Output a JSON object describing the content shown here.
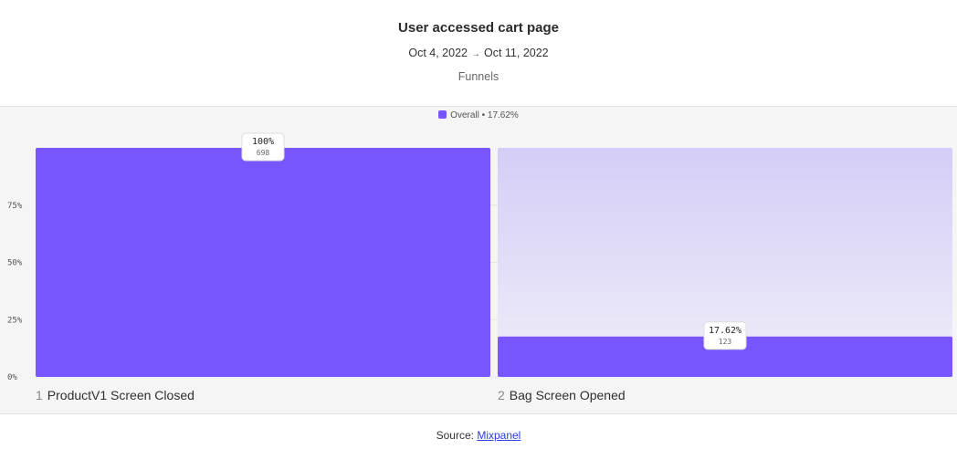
{
  "header": {
    "title": "User accessed cart page",
    "date_start": "Oct 4, 2022",
    "date_arrow": "→",
    "date_end": "Oct 11, 2022",
    "subtitle": "Funnels"
  },
  "legend": {
    "label": "Overall • 17.62%",
    "color": "#7856ff"
  },
  "chart_data": {
    "type": "bar",
    "categories": [
      "ProductV1 Screen Closed",
      "Bag Screen Opened"
    ],
    "step_numbers": [
      "1",
      "2"
    ],
    "values": [
      100,
      17.62
    ],
    "counts": [
      698,
      123
    ],
    "value_labels": [
      "100%",
      "17.62%"
    ],
    "count_labels": [
      "698",
      "123"
    ],
    "ylim": [
      0,
      100
    ],
    "yticks": [
      0,
      25,
      50,
      75
    ],
    "ytick_labels": [
      "0%",
      "25%",
      "50%",
      "75%"
    ],
    "series": [
      {
        "name": "Overall • 17.62%",
        "values": [
          100,
          17.62
        ]
      }
    ],
    "colors": {
      "bar": "#7856ff",
      "dropoff_top": "#d4cdf7",
      "dropoff_bottom": "#ebe8f8",
      "grid": "#e6e6e6"
    }
  },
  "footer": {
    "source_prefix": "Source:",
    "source_link": "Mixpanel"
  }
}
